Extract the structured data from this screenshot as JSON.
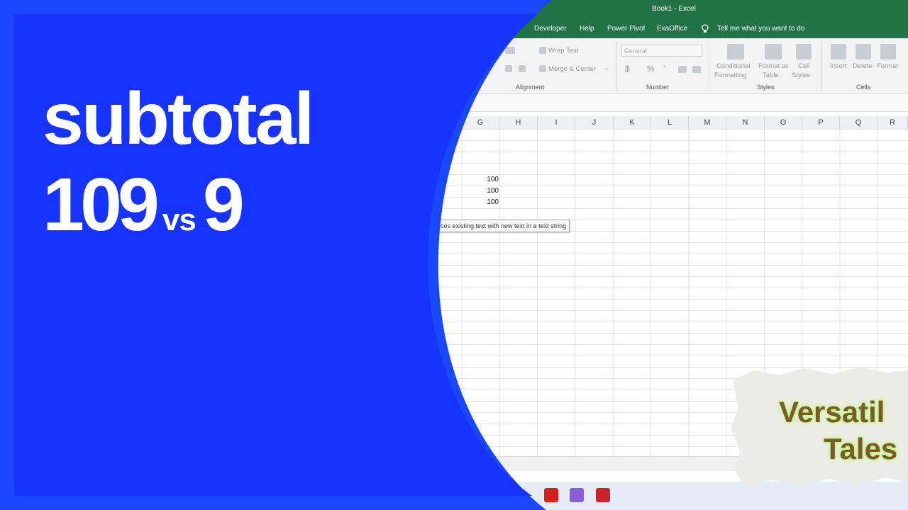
{
  "excel": {
    "title": "Book1  -  Excel",
    "menu": {
      "developer": "Developer",
      "help": "Help",
      "power_pivot": "Power Pivot",
      "exaoffice": "ExaOffice",
      "tell_me": "Tell me what you want to do"
    },
    "ribbon": {
      "wrap_text": "Wrap Text",
      "merge_center": "Merge & Center",
      "number_format": "General",
      "currency": "$",
      "percent": "%",
      "comma": "’",
      "conditional_formatting_1": "Conditional",
      "conditional_formatting_2": "Formatting",
      "format_as_table_1": "Format as",
      "format_as_table_2": "Table",
      "cell_styles_1": "Cell",
      "cell_styles_2": "Styles",
      "insert": "Insert",
      "delete": "Delete",
      "format": "Format",
      "groups": {
        "alignment": "Alignment",
        "number": "Number",
        "styles": "Styles",
        "cells": "Cells"
      }
    },
    "columns": [
      "G",
      "H",
      "I",
      "J",
      "K",
      "L",
      "M",
      "N",
      "O",
      "P",
      "Q",
      "R"
    ],
    "cells": {
      "g1": "100",
      "g2": "100",
      "g3": "100"
    },
    "tooltip": "ces existing text with new text in a text string"
  },
  "headline": {
    "line1": "subtotal",
    "num_a": "109",
    "vs": "vs",
    "num_b": "9"
  },
  "logo": {
    "line1": "Versatil",
    "line2": "Tales"
  },
  "colors": {
    "blue": "#1847ff",
    "excel_green": "#217346"
  }
}
